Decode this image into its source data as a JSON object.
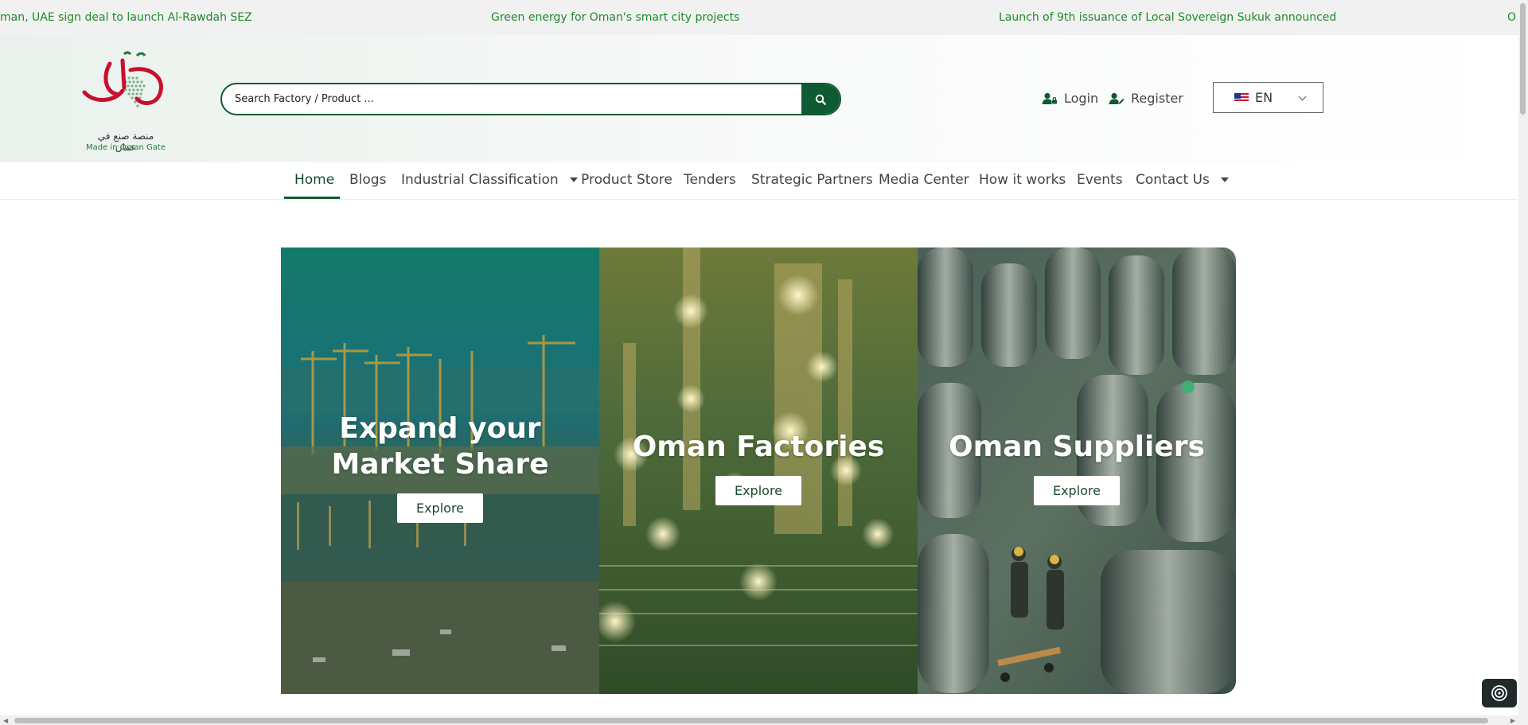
{
  "ticker": {
    "items": [
      "man, UAE sign deal to launch Al-Rawdah SEZ",
      "Green energy for Oman's smart city projects",
      "Launch of 9th issuance of Local Sovereign Sukuk announced",
      "O"
    ]
  },
  "header": {
    "logo": {
      "arabic_text": "منصة صنع في عمان",
      "english_text": "Made in Oman Gate"
    },
    "search": {
      "placeholder": "Search Factory / Product ...",
      "button_icon": "search-icon"
    },
    "login_label": "Login",
    "register_label": "Register",
    "language": {
      "selected": "EN"
    }
  },
  "nav": {
    "items": [
      {
        "label": "Home",
        "active": true
      },
      {
        "label": "Blogs"
      },
      {
        "label": "Industrial Classification",
        "dropdown": true
      },
      {
        "label": "Product Store"
      },
      {
        "label": "Tenders"
      },
      {
        "label": "Strategic Partners"
      },
      {
        "label": "Media Center"
      },
      {
        "label": "How it works"
      },
      {
        "label": "Events"
      },
      {
        "label": "Contact Us",
        "dropdown": true
      }
    ]
  },
  "hero": {
    "panels": [
      {
        "title": "Expand your Market Share",
        "button": "Explore"
      },
      {
        "title": "Oman Factories",
        "button": "Explore"
      },
      {
        "title": "Oman Suppliers",
        "button": "Explore"
      }
    ]
  },
  "colors": {
    "brand_green": "#0f5a32",
    "ticker_green": "#1f8a2b",
    "logo_red": "#c8102e"
  }
}
